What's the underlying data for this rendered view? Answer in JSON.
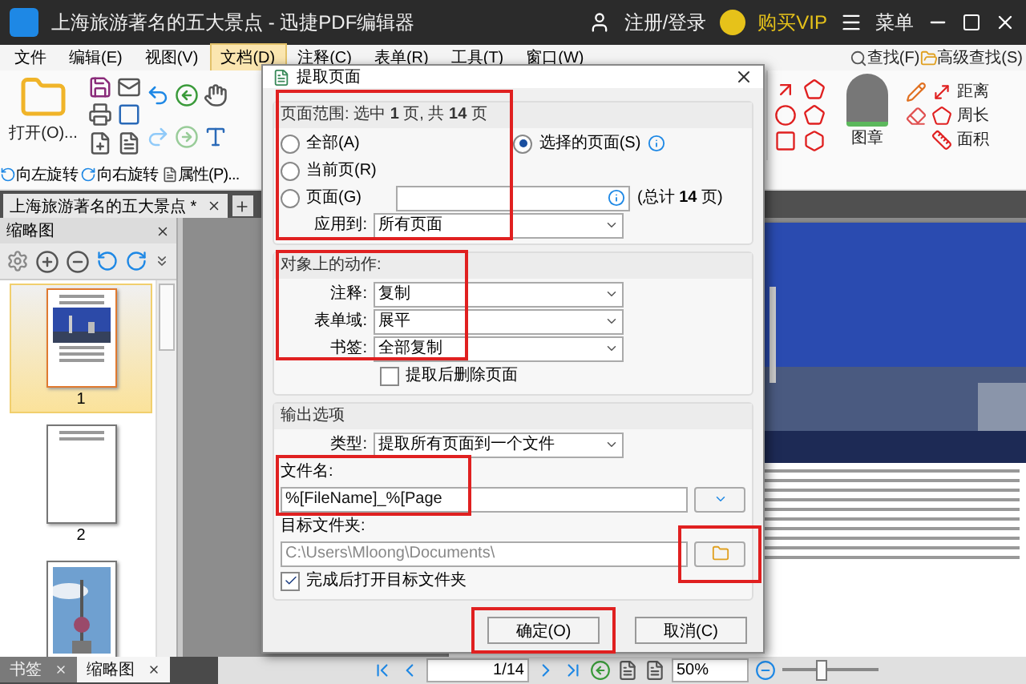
{
  "window": {
    "title": "上海旅游著名的五大景点 - 迅捷PDF编辑器",
    "account": "注册/登录",
    "vip": "购买VIP",
    "menu": "菜单"
  },
  "menu_bar": [
    {
      "label": "文件",
      "selected": false
    },
    {
      "label": "编辑(E)",
      "selected": false
    },
    {
      "label": "视图(V)",
      "selected": false
    },
    {
      "label": "文档(D)",
      "selected": true
    },
    {
      "label": "注释(C)",
      "selected": false
    },
    {
      "label": "表单(R)",
      "selected": false
    },
    {
      "label": "工具(T)",
      "selected": false
    },
    {
      "label": "窗口(W)",
      "selected": false
    }
  ],
  "find": {
    "find": "查找(F)",
    "advanced": "高级查找(S)"
  },
  "ribbon": {
    "open": "打开(O)...",
    "rotate_left": "向左旋转",
    "rotate_right": "向右旋转",
    "properties": "属性(P)...",
    "stamp": "图章",
    "distance": "距离",
    "perimeter": "周长",
    "area": "面积"
  },
  "doc_tabs": [
    {
      "label": "上海旅游著名的五大景点 *",
      "selected": true
    }
  ],
  "thumbnail_panel": {
    "title": "缩略图",
    "pages": [
      {
        "label": "1",
        "selected": true
      },
      {
        "kind": "text",
        "label": "2",
        "selected": false
      },
      {
        "kind": "tower",
        "selected": false
      }
    ]
  },
  "bottom_tabs": [
    {
      "label": "书签",
      "selected": false
    },
    {
      "label": "缩略图",
      "selected": true
    }
  ],
  "status_bar": {
    "page": "1/14",
    "zoom": "50%"
  },
  "zoom_slider": {
    "level": 0.4
  },
  "dialog": {
    "title": "提取页面",
    "page_range": {
      "heading": "页面范围: 选中 **1** 页, 共 **14** 页",
      "options": [
        {
          "label": "全部(A)",
          "selected": false
        },
        {
          "label": "当前页(R)",
          "selected": false
        },
        {
          "label": "页面(G)",
          "selected": false
        },
        {
          "label": "选择的页面(S)",
          "selected": true
        }
      ],
      "total": "(总计 **14** 页)",
      "apply_label": "应用到:",
      "apply_value": "所有页面"
    },
    "actions": {
      "heading": "对象上的动作:",
      "selects": [
        {
          "label": "注释:",
          "value": "复制"
        },
        {
          "label": "表单域:",
          "value": "展平"
        },
        {
          "label": "书签:",
          "value": "全部复制"
        }
      ],
      "delete_after": {
        "label": "提取后删除页面",
        "checked": false
      }
    },
    "output": {
      "heading": "输出选项",
      "type_label": "类型:",
      "type_value": "提取所有页面到一个文件",
      "filename_label": "文件名:",
      "filename": "%[FileName]_%[Page",
      "folder_label": "目标文件夹:",
      "folder": "C:\\Users\\Mloong\\Documents\\",
      "open_after": {
        "label": "完成后打开目标文件夹",
        "checked": true
      }
    },
    "buttons": [
      "确定(O)",
      "取消(C)"
    ]
  }
}
